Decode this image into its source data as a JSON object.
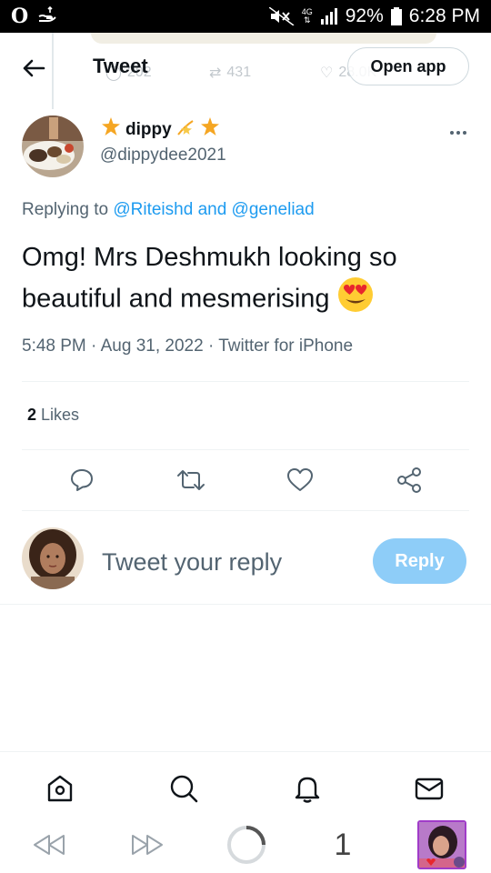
{
  "status_bar": {
    "browser_logo": "O",
    "network": "4G",
    "battery_percent": "92%",
    "time": "6:28 PM",
    "icons": [
      "opera-icon",
      "hand-icon",
      "mute-icon",
      "signal-icon",
      "battery-icon"
    ]
  },
  "header": {
    "title": "Tweet",
    "open_app_label": "Open app",
    "ghost_counts": {
      "replies": "202",
      "retweets": "431",
      "likes": "28.0K"
    }
  },
  "tweet": {
    "author_name": "dippy",
    "author_handle": "@dippydee2021",
    "replying_prefix": "Replying to",
    "mention_1": "@Riteishd",
    "and_word": "and",
    "mention_2": "@geneliad",
    "text": "Omg! Mrs Deshmukh looking so beautiful and mesmerising",
    "time": "5:48 PM",
    "date": "Aug 31, 2022",
    "source": "Twitter for iPhone",
    "separator": "·",
    "likes_count": "2",
    "likes_label": "Likes"
  },
  "reply_box": {
    "placeholder": "Tweet your reply",
    "button_label": "Reply"
  },
  "bottom_nav": {
    "items": [
      "home-icon",
      "search-icon",
      "notifications-icon",
      "messages-icon"
    ]
  },
  "browser_bar": {
    "tab_count": "1"
  },
  "colors": {
    "accent": "#1d9bf0",
    "reply_button": "#8ecdf8",
    "secondary_text": "#536471",
    "primary_text": "#0f1419",
    "opera_thumb_border": "#a03cc8"
  }
}
